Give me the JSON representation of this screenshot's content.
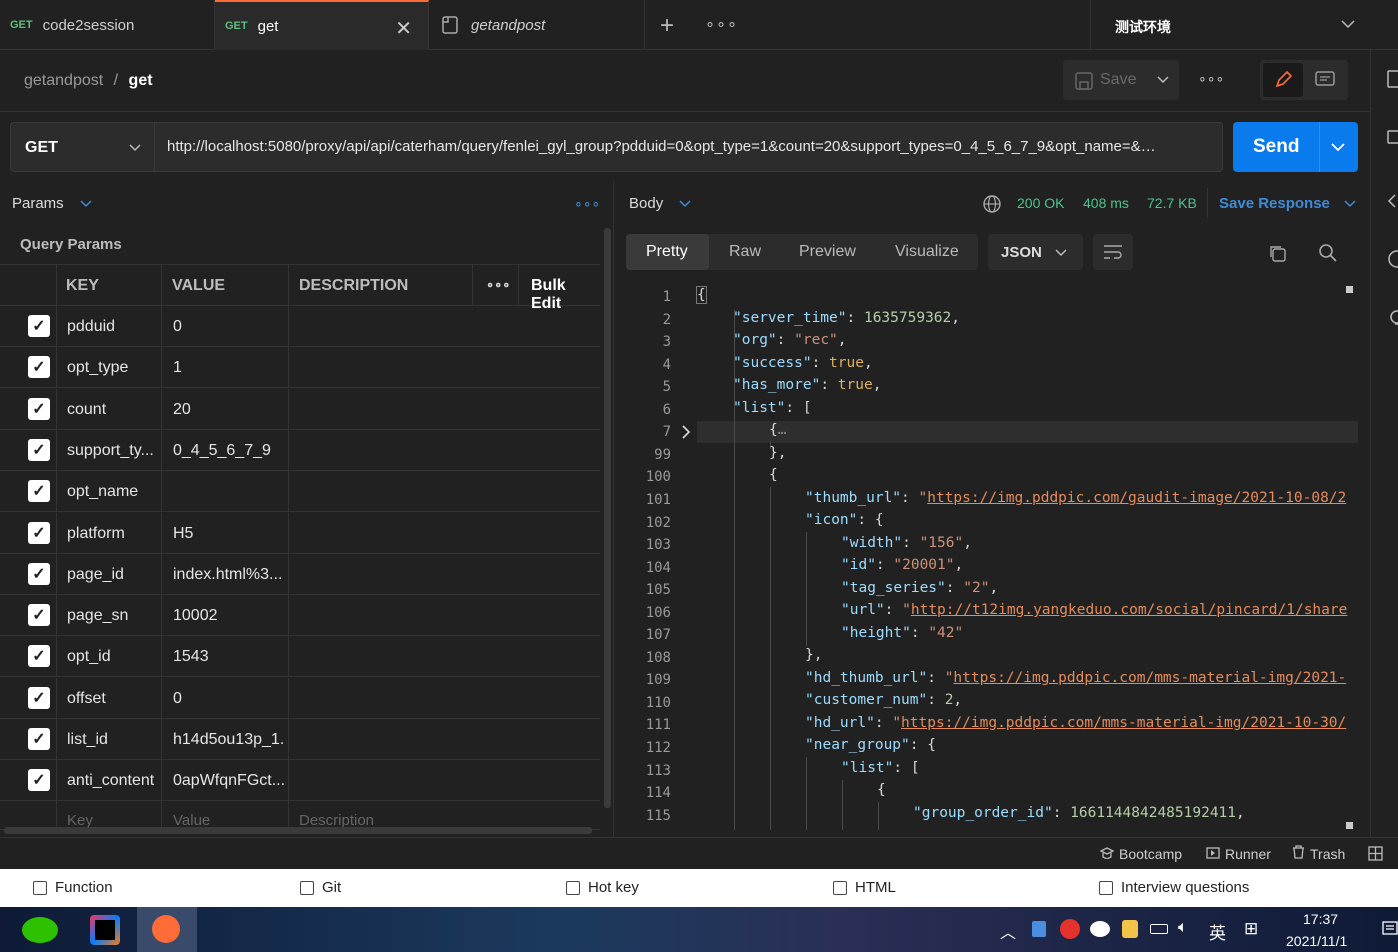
{
  "tabs": [
    {
      "method": "GET",
      "name": "code2session"
    },
    {
      "method": "GET",
      "name": "get"
    },
    {
      "name": "getandpost"
    }
  ],
  "environment": "测试环境",
  "breadcrumb": {
    "parent": "getandpost",
    "sep": "/",
    "current": "get"
  },
  "save_label": "Save",
  "request": {
    "method": "GET",
    "url": "http://localhost:5080/proxy/api/api/caterham/query/fenlei_gyl_group?pdduid=0&opt_type=1&count=20&support_types=0_4_5_6_7_9&opt_name=&…",
    "send_label": "Send"
  },
  "left_panel": {
    "tab": "Params",
    "section": "Query Params",
    "columns": {
      "key": "KEY",
      "value": "VALUE",
      "description": "DESCRIPTION",
      "bulk": "Bulk Edit"
    },
    "rows": [
      {
        "key": "pdduid",
        "value": "0"
      },
      {
        "key": "opt_type",
        "value": "1"
      },
      {
        "key": "count",
        "value": "20"
      },
      {
        "key": "support_ty...",
        "value": "0_4_5_6_7_9"
      },
      {
        "key": "opt_name",
        "value": ""
      },
      {
        "key": "platform",
        "value": "H5"
      },
      {
        "key": "page_id",
        "value": "index.html%3..."
      },
      {
        "key": "page_sn",
        "value": "10002"
      },
      {
        "key": "opt_id",
        "value": "1543"
      },
      {
        "key": "offset",
        "value": "0"
      },
      {
        "key": "list_id",
        "value": "h14d5ou13p_1..."
      },
      {
        "key": "anti_content",
        "value": "0apWfqnFGct..."
      }
    ],
    "placeholder": {
      "key": "Key",
      "value": "Value",
      "description": "Description"
    }
  },
  "response": {
    "tab": "Body",
    "status": "200 OK",
    "time": "408 ms",
    "size": "72.7 KB",
    "save_response": "Save Response",
    "views": [
      "Pretty",
      "Raw",
      "Preview",
      "Visualize"
    ],
    "format": "JSON",
    "line_numbers": [
      "1",
      "2",
      "3",
      "4",
      "5",
      "6",
      "7",
      "99",
      "100",
      "101",
      "102",
      "103",
      "104",
      "105",
      "106",
      "107",
      "108",
      "109",
      "110",
      "111",
      "112",
      "113",
      "114",
      "115"
    ]
  },
  "statusbar": {
    "bootcamp": "Bootcamp",
    "runner": "Runner",
    "trash": "Trash"
  },
  "checkbar": [
    "Function",
    "Git",
    "Hot key",
    "HTML",
    "Interview questions"
  ],
  "taskbar": {
    "time": "17:37",
    "date": "2021/11/1",
    "ime": "英"
  }
}
